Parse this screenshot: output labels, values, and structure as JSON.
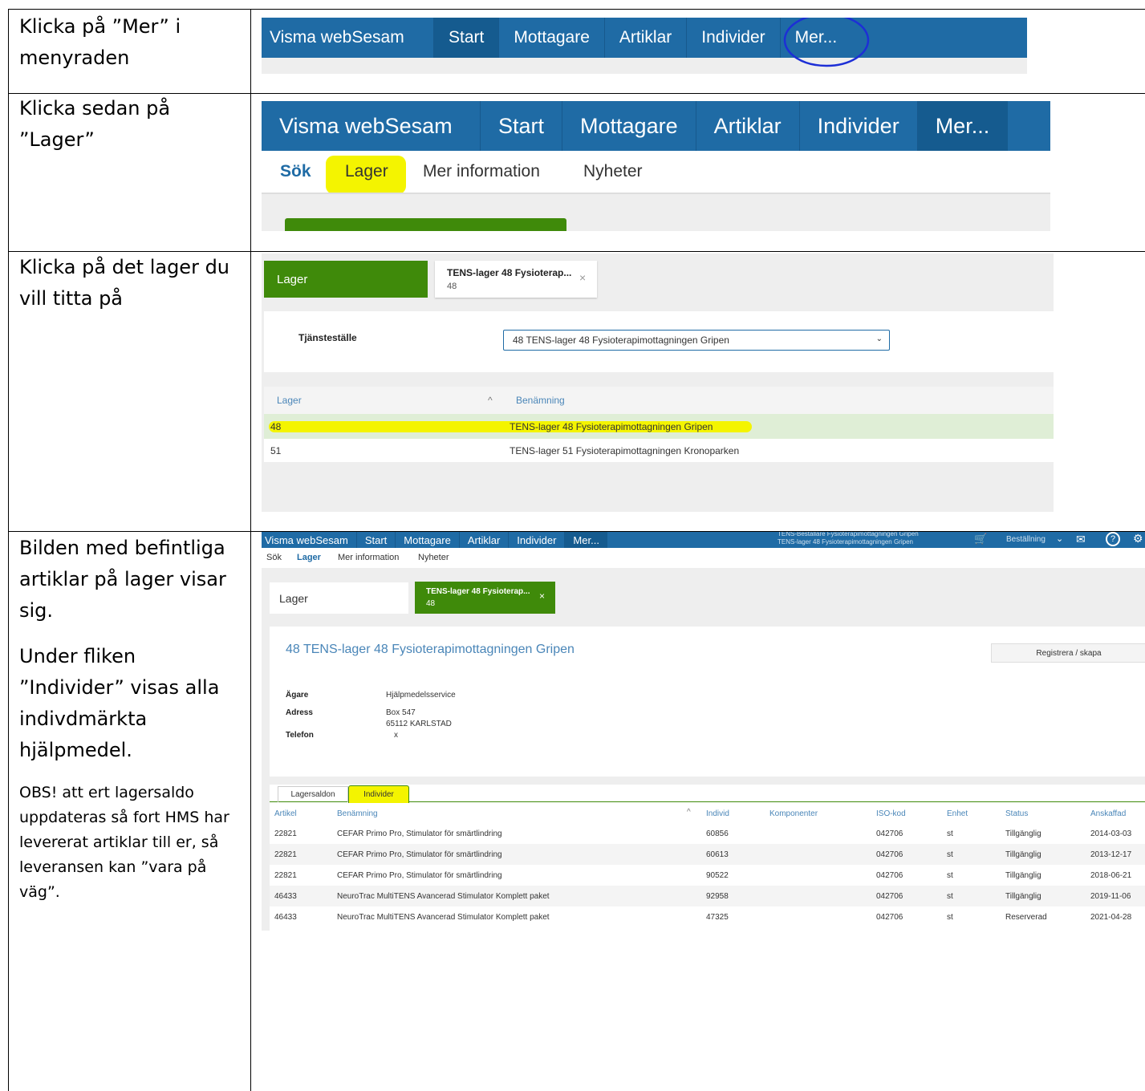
{
  "instructions": {
    "step1": "Klicka på ”Mer” i menyraden",
    "step2": "Klicka sedan på ”Lager”",
    "step3": "Klicka på det lager du vill titta på",
    "step4_p1": "Bilden med befintliga artiklar på lager visar sig.",
    "step4_p2": "Under fliken ”Individer” visas alla indivdmärkta hjälpmedel.",
    "step4_note": "OBS! att ert lagersaldo uppdateras så fort HMS har levererat artiklar till er, så leveransen kan ”vara på väg”."
  },
  "nav": {
    "brand": "Visma webSesam",
    "start": "Start",
    "mottagare": "Mottagare",
    "artiklar": "Artiklar",
    "individer": "Individer",
    "mer": "Mer..."
  },
  "subnav": {
    "sok": "Sök",
    "lager": "Lager",
    "mer_information": "Mer information",
    "nyheter": "Nyheter"
  },
  "lager_screen": {
    "lager_button": "Lager",
    "tab_title": "TENS-lager 48 Fysioterap...",
    "tab_sub": "48",
    "close": "×",
    "tjanstestalle_label": "Tjänsteställe",
    "tjanstestalle_value": "48 TENS-lager 48 Fysioterapimottagningen Gripen",
    "col_lager": "Lager",
    "col_benamning": "Benämning",
    "sort_arrow": "^",
    "rows": [
      {
        "lager": "48",
        "benamning": "TENS-lager 48 Fysioterapimottagningen Gripen"
      },
      {
        "lager": "51",
        "benamning": "TENS-lager 51 Fysioterapimottagningen Kronoparken"
      }
    ]
  },
  "detail_screen": {
    "top_right_line1": "TENS-Beställare Fysioterapimottagningen Gripen",
    "top_right_line2": "TENS-lager 48 Fysioterapimottagningen Gripen",
    "bestallning": "Beställning",
    "help": "?",
    "title": "48 TENS-lager 48 Fysioterapimottagningen Gripen",
    "register_button": "Registrera / skapa",
    "agare_label": "Ägare",
    "agare_value": "Hjälpmedelsservice",
    "adress_label": "Adress",
    "adress_line1": "Box 547",
    "adress_line2": "65112 KARLSTAD",
    "telefon_label": "Telefon",
    "telefon_value": "x",
    "tab_lagersaldon": "Lagersaldon",
    "tab_individer": "Individer",
    "columns": [
      "Artikel",
      "Benämning",
      "Individ",
      "Komponenter",
      "ISO-kod",
      "Enhet",
      "Status",
      "Anskaffad"
    ],
    "rows": [
      {
        "artikel": "22821",
        "benamning": "CEFAR Primo Pro, Stimulator för smärtlindring",
        "individ": "60856",
        "komponenter": "",
        "iso": "042706",
        "enhet": "st",
        "status": "Tillgänglig",
        "anskaffad": "2014-03-03"
      },
      {
        "artikel": "22821",
        "benamning": "CEFAR Primo Pro, Stimulator för smärtlindring",
        "individ": "60613",
        "komponenter": "",
        "iso": "042706",
        "enhet": "st",
        "status": "Tillgänglig",
        "anskaffad": "2013-12-17"
      },
      {
        "artikel": "22821",
        "benamning": "CEFAR Primo Pro, Stimulator för smärtlindring",
        "individ": "90522",
        "komponenter": "",
        "iso": "042706",
        "enhet": "st",
        "status": "Tillgänglig",
        "anskaffad": "2018-06-21"
      },
      {
        "artikel": "46433",
        "benamning": "NeuroTrac MultiTENS Avancerad Stimulator Komplett paket",
        "individ": "92958",
        "komponenter": "",
        "iso": "042706",
        "enhet": "st",
        "status": "Tillgänglig",
        "anskaffad": "2019-11-06"
      },
      {
        "artikel": "46433",
        "benamning": "NeuroTrac MultiTENS Avancerad Stimulator Komplett paket",
        "individ": "47325",
        "komponenter": "",
        "iso": "042706",
        "enhet": "st",
        "status": "Reserverad",
        "anskaffad": "2021-04-28"
      }
    ]
  },
  "colors": {
    "nav_blue": "#1f6ba5",
    "green": "#3f8a0a",
    "highlight": "#f4f400",
    "circle": "#1d2fd6"
  }
}
